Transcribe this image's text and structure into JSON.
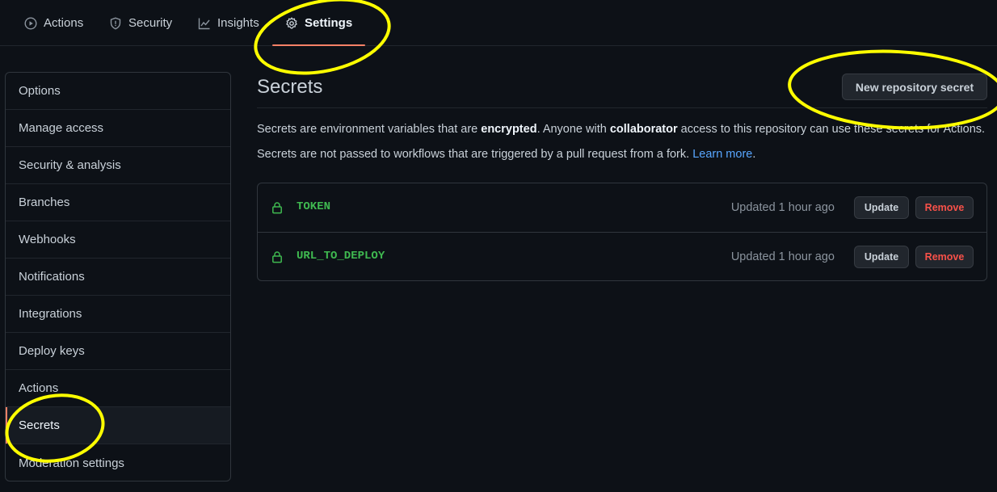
{
  "tabs": [
    {
      "label": "Actions",
      "icon": "play-icon"
    },
    {
      "label": "Security",
      "icon": "shield-icon"
    },
    {
      "label": "Insights",
      "icon": "graph-icon"
    },
    {
      "label": "Settings",
      "icon": "gear-icon",
      "active": true
    }
  ],
  "sidebar": {
    "items": [
      {
        "label": "Options"
      },
      {
        "label": "Manage access"
      },
      {
        "label": "Security & analysis"
      },
      {
        "label": "Branches"
      },
      {
        "label": "Webhooks"
      },
      {
        "label": "Notifications"
      },
      {
        "label": "Integrations"
      },
      {
        "label": "Deploy keys"
      },
      {
        "label": "Actions"
      },
      {
        "label": "Secrets",
        "selected": true
      },
      {
        "label": "Moderation settings"
      }
    ]
  },
  "main": {
    "title": "Secrets",
    "new_button_label": "New repository secret",
    "desc1": {
      "a": "Secrets are environment variables that are ",
      "b": "encrypted",
      "c": ". Anyone with ",
      "d": "collaborator",
      "e": " access to this repository can use these secrets for Actions."
    },
    "desc2": {
      "text": "Secrets are not passed to workflows that are triggered by a pull request from a fork. ",
      "link": "Learn more",
      "end": "."
    },
    "secrets": [
      {
        "name": "TOKEN",
        "updated": "Updated 1 hour ago",
        "update_label": "Update",
        "remove_label": "Remove"
      },
      {
        "name": "URL_TO_DEPLOY",
        "updated": "Updated 1 hour ago",
        "update_label": "Update",
        "remove_label": "Remove"
      }
    ]
  },
  "colors": {
    "background": "#0d1117",
    "accent_underline": "#f78166",
    "secret_name": "#3fb950",
    "remove": "#f85149",
    "link": "#58a6ff",
    "annotation": "#ffff00"
  }
}
